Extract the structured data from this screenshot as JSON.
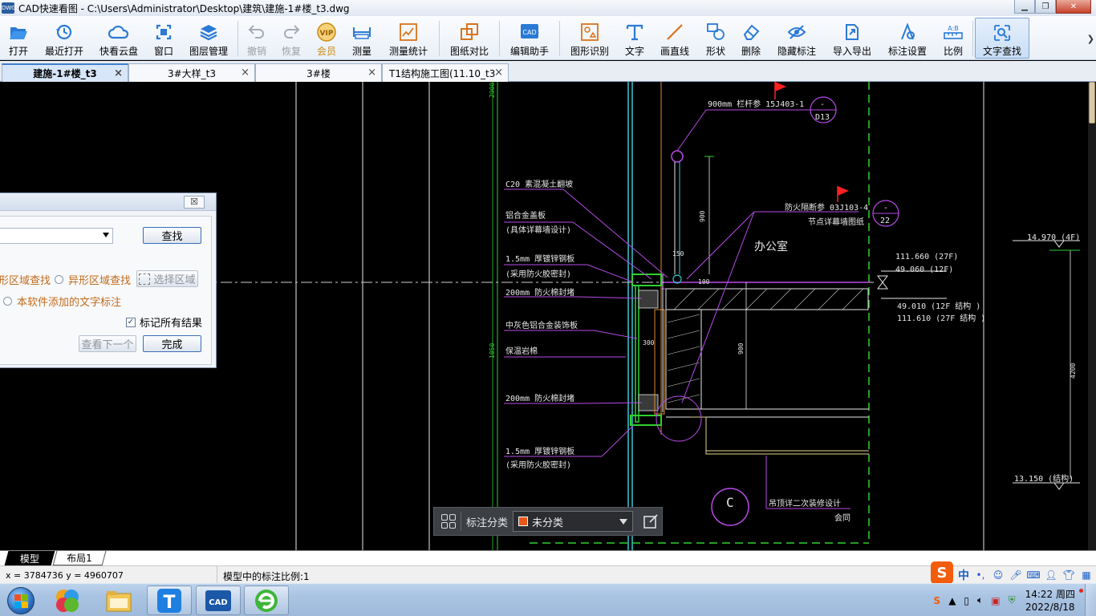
{
  "window": {
    "title": "CAD快速看图 - C:\\Users\\Administrator\\Desktop\\建筑\\建施-1#楼_t3.dwg",
    "app_icon_text": "DWG"
  },
  "toolbar": {
    "items": [
      {
        "label": "打开",
        "icon": "folder-open-icon"
      },
      {
        "label": "最近打开",
        "icon": "history-icon"
      },
      {
        "label": "快看云盘",
        "icon": "cloud-icon"
      },
      {
        "label": "窗口",
        "icon": "window-icon"
      },
      {
        "label": "图层管理",
        "icon": "layers-icon"
      },
      {
        "label": "撤销",
        "icon": "undo-icon",
        "disabled": true
      },
      {
        "label": "恢复",
        "icon": "redo-icon",
        "disabled": true
      },
      {
        "label": "会员",
        "icon": "vip-icon",
        "vip": true
      },
      {
        "label": "测量",
        "icon": "ruler-icon"
      },
      {
        "label": "测量统计",
        "icon": "measure-stats-icon"
      },
      {
        "label": "图纸对比",
        "icon": "compare-icon"
      },
      {
        "label": "编辑助手",
        "icon": "edit-helper-icon"
      },
      {
        "label": "图形识别",
        "icon": "shape-recognize-icon"
      },
      {
        "label": "文字",
        "icon": "text-icon"
      },
      {
        "label": "画直线",
        "icon": "line-icon"
      },
      {
        "label": "形状",
        "icon": "shape-icon"
      },
      {
        "label": "删除",
        "icon": "eraser-icon"
      },
      {
        "label": "隐藏标注",
        "icon": "hide-annotation-icon"
      },
      {
        "label": "导入导出",
        "icon": "import-export-icon"
      },
      {
        "label": "标注设置",
        "icon": "annotation-settings-icon"
      },
      {
        "label": "比例",
        "icon": "scale-icon"
      },
      {
        "label": "文字查找",
        "icon": "text-search-icon",
        "active": true
      }
    ],
    "more_label": "❯"
  },
  "tabs": [
    {
      "label": "建施-1#楼_t3",
      "active": true
    },
    {
      "label": "3#大样_t3"
    },
    {
      "label": "3#楼"
    },
    {
      "label": "T1结构施工图(11.10_t3"
    }
  ],
  "find_dialog": {
    "close_label": "☒",
    "search_value": "",
    "find_button": "查找",
    "option_rect_area": "形区域查找",
    "option_irregular_area": "异形区域查找",
    "select_area_button": "选择区域",
    "option_software_text": "本软件添加的文字标注",
    "mark_all_label": "标记所有结果",
    "mark_all_checked": true,
    "next_button": "查看下一个",
    "done_button": "完成"
  },
  "drawing": {
    "texts": {
      "railing_note": "900mm  栏杆参  15J403-1",
      "d13_top": "-",
      "d13": "D13",
      "c20": "C20  素混凝土翻坡",
      "alu_cover": "铝合金盖板",
      "alu_cover_sub": "(具体详幕墙设计)",
      "steel_15_a": "1.5mm   厚镀锌钢板",
      "steel_15_a_sub": "(采用防火胶密封)",
      "fire_200_a": "200mm   防火棉封堵",
      "grey_alu": "中灰色铝合金装饰板",
      "rockwool": "保温岩棉",
      "fire_200_b": "200mm   防火棉封堵",
      "steel_15_b": "1.5mm   厚镀锌钢板",
      "steel_15_b_sub": "(采用防火胶密封)",
      "fire_partition": "防火隔断参   03J103-4",
      "node_detail": "节点详幕墙图纸",
      "n22_top": "-",
      "n22": "22",
      "office": "办公室",
      "elev_a1": "111.660    (27F)",
      "elev_a2": "49.060    (12F)",
      "elev_b1": "49.010    (12F  结构 )",
      "elev_b2": "111.610    (27F  结构 )",
      "elev_c": "14.970    (4F)",
      "elev_d": "13.150    (结构)",
      "ceiling": "吊顶详二次装修设计",
      "elec": "会同",
      "dim_150": "150",
      "dim_100": "100",
      "dim_300": "300",
      "dim_900_a": "900",
      "dim_900_b": "900",
      "dim_1050": "1050",
      "dim_2900": "2900",
      "dim_4200": "4200",
      "circle_c": "C"
    }
  },
  "annotation_bar": {
    "grid_icon": "grid-icon",
    "label": "标注分类",
    "category": "未分类",
    "category_color": "#e8561a",
    "edit_icon": "edit-icon"
  },
  "layout_tabs": [
    {
      "label": "模型",
      "active": true
    },
    {
      "label": "布局1"
    }
  ],
  "statusbar": {
    "coords": "x = 3784736  y = 4960707",
    "scale_text": "模型中的标注比例:1",
    "ime_logo": "S",
    "ime_mode": "中",
    "ime_punct": "•,"
  },
  "taskbar": {
    "apps": [
      {
        "name": "start-button"
      },
      {
        "name": "app-colorful"
      },
      {
        "name": "explorer"
      },
      {
        "name": "app-t"
      },
      {
        "name": "cad-viewer",
        "label": "CAD"
      },
      {
        "name": "browser"
      }
    ],
    "time": "14:22 周四",
    "date": "2022/8/18",
    "tray_ime": "S"
  }
}
